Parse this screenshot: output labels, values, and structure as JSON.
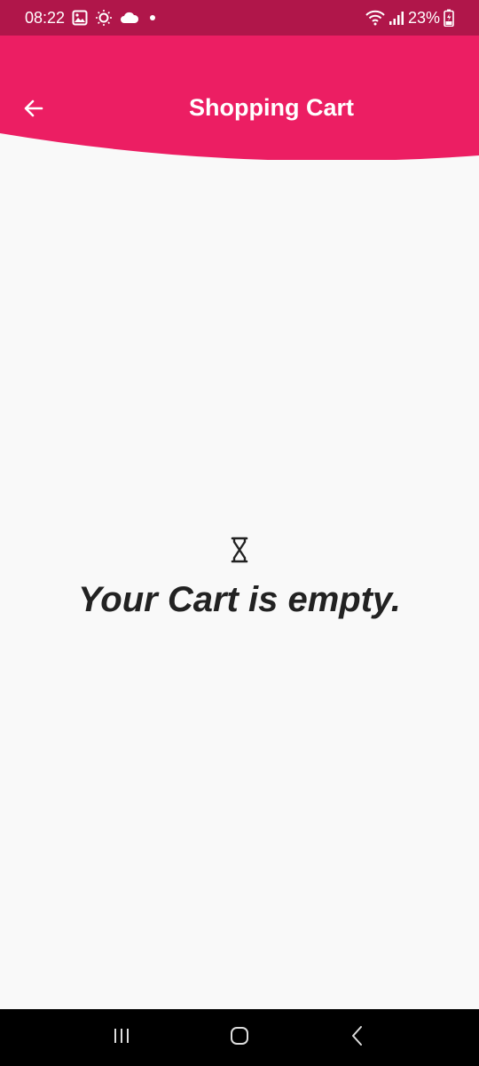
{
  "status_bar": {
    "time": "08:22",
    "battery": "23%"
  },
  "header": {
    "title": "Shopping Cart",
    "background_color": "#ec1e63",
    "status_color": "#b0164a"
  },
  "cart": {
    "empty_icon": "hourglass-icon",
    "empty_message": "Your Cart is empty."
  },
  "icons": {
    "back": "arrow-left-icon",
    "nav_recents": "recents-icon",
    "nav_home": "home-icon",
    "nav_back": "back-chevron-icon"
  }
}
